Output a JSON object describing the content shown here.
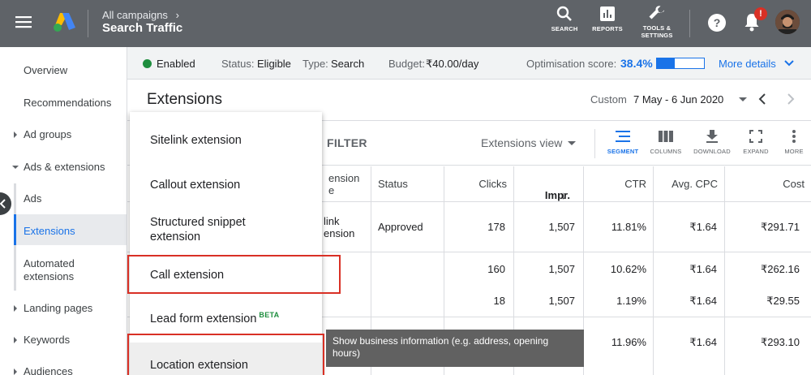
{
  "header": {
    "breadcrumb_parent": "All campaigns",
    "campaign_title": "Search Traffic",
    "buttons": {
      "search": "SEARCH",
      "reports": "REPORTS",
      "tools_line1": "TOOLS &",
      "tools_line2": "SETTINGS"
    },
    "notification_badge": "!"
  },
  "sidebar": {
    "items": [
      "Overview",
      "Recommendations",
      "Ad groups",
      "Ads & extensions",
      "Ads",
      "Extensions",
      "Automated extensions",
      "Landing pages",
      "Keywords",
      "Audiences"
    ]
  },
  "summary": {
    "status_state": "Enabled",
    "status_label": "Status:",
    "status_value": "Eligible",
    "type_label": "Type:",
    "type_value": "Search",
    "budget_label": "Budget:",
    "budget_value": "₹40.00/day",
    "optimisation_label": "Optimisation score:",
    "optimisation_value": "38.4%",
    "optimisation_fraction": 0.384,
    "more_details": "More details"
  },
  "page": {
    "title": "Extensions",
    "date_label": "Custom",
    "date_range": "7 May - 6 Jun 2020"
  },
  "toolbar": {
    "filter": "FILTER",
    "view": "Extensions view",
    "segment": "SEGMENT",
    "columns": "COLUMNS",
    "download": "DOWNLOAD",
    "expand": "EXPAND",
    "more": "MORE"
  },
  "table": {
    "partial_header_line1": "ension",
    "partial_header_line2": "e",
    "headers": [
      "Status",
      "Clicks",
      "Impr.",
      "CTR",
      "Avg. CPC",
      "Cost"
    ],
    "rows": [
      {
        "partial1": "link",
        "partial2": "ension",
        "status": "Approved",
        "clicks": "178",
        "impr": "1,507",
        "ctr": "11.81%",
        "cpc": "₹1.64",
        "cost": "₹291.71"
      },
      {
        "partial1": "",
        "partial2": "",
        "status": "",
        "clicks": "160",
        "impr": "1,507",
        "ctr": "10.62%",
        "cpc": "₹1.64",
        "cost": "₹262.16"
      },
      {
        "partial1": "",
        "partial2": "",
        "status": "",
        "clicks": "18",
        "impr": "1,507",
        "ctr": "1.19%",
        "cpc": "₹1.64",
        "cost": "₹29.55"
      },
      {
        "partial1": "",
        "partial2": "",
        "status": "",
        "clicks": "",
        "impr": "",
        "ctr": "11.96%",
        "cpc": "₹1.64",
        "cost": "₹293.10"
      }
    ]
  },
  "dropdown": {
    "items": [
      "Sitelink extension",
      "Callout extension",
      "Structured snippet extension",
      "Call extension",
      "Lead form extension",
      "Location extension"
    ],
    "beta_badge": "BETA"
  },
  "tooltip": {
    "text": "Show business information (e.g. address, opening hours)"
  },
  "colors": {
    "accent": "#1a73e8",
    "topbar": "#5f6368",
    "enabled_green": "#1e8e3e",
    "highlight_red": "#d93025"
  }
}
